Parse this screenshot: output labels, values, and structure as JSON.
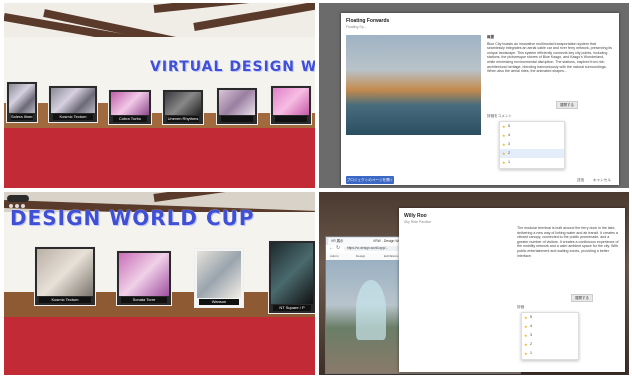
{
  "panel1": {
    "sign": "VIRTUAL DESIGN WORLD",
    "posters": [
      {
        "caption": "Solera Itinera"
      },
      {
        "caption": "Kosmic Tectum"
      },
      {
        "caption": "Cobra Turbo"
      },
      {
        "caption": "Uneven Rhythms"
      },
      {
        "caption": ""
      }
    ]
  },
  "panel2": {
    "title": "Floating Forwards",
    "subtitle": "Floating Sp...",
    "body_heading": "概要",
    "body": "Blue City boasts an innovative multimodal transportation system that seamlessly integrates an aerial cable car and river ferry network, preserving its unique landscape. This system efficiently connects key city points, including stations, the picturesque shores of Blue Kasgo, and Kasgo's Wonderland, while minimizing environmental disruption. The stations, inspired from rich architectural heritage, blending harmoniously with the natural surroundings. When also the aerial rides, the animated shapes...",
    "expand_button": "展開する",
    "rating_label": "評価をコメント",
    "rating_options": [
      "5",
      "4",
      "3",
      "2",
      "1"
    ],
    "selected_option": "2",
    "project_button": "プロジェクトのページを開く",
    "confirm_button": "送信",
    "cancel_button": "キャンセル"
  },
  "panel3": {
    "sign": "DESIGN WORLD CUP",
    "posters": [
      {
        "caption": "Kosmic Tectum"
      },
      {
        "caption": "Sonata Torre"
      },
      {
        "caption": "Wanson"
      },
      {
        "caption": "NT Square / P"
      }
    ]
  },
  "panel4": {
    "tabs": [
      "VR 展示",
      "VRW - Design Web ×"
    ],
    "url": "https://vr-design-world.app/...",
    "bookmarks": [
      "Admin",
      "Design",
      "Exhibitions",
      "Projects",
      "Gallery",
      "Users"
    ],
    "dialog_title": "Willy Roo",
    "dialog_subtitle": "Sky Ride Pavilion",
    "body": "The modular terminal is built around the ferry dock in the lake, delivering a new way of linking water and air transit. It creates a vibrant canopy, connected to the public promenade, and a greater number of visitors. It creates a continuous experience of the mobility network and a calm ambient space for the city. With public entertainment and waiting zones, providing a better interface.",
    "expand_button": "展開する",
    "rating_label": "評価",
    "rating_options": [
      "5",
      "4",
      "3",
      "2",
      "1"
    ]
  },
  "colors": {
    "floor": "#c22a35",
    "wall": "#f5f3ee",
    "wood": "#a06a3e",
    "sign_text": "#3f4fd6",
    "primary": "#3b68c4"
  }
}
